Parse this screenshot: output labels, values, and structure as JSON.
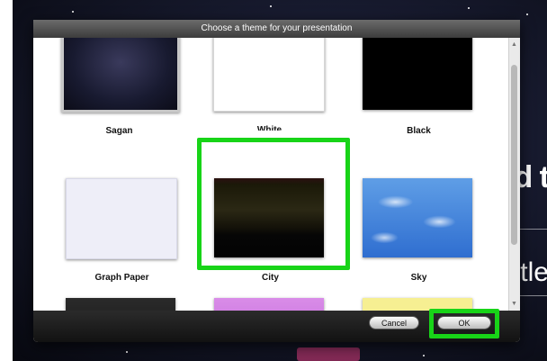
{
  "dialog": {
    "title": "Choose a theme for your presentation",
    "themes": [
      {
        "label": "Sagan"
      },
      {
        "label": "White"
      },
      {
        "label": "Black"
      },
      {
        "label": "Graph Paper"
      },
      {
        "label": "City"
      },
      {
        "label": "Sky"
      }
    ],
    "cancel_label": "Cancel",
    "ok_label": "OK"
  },
  "background_slide": {
    "text_fragment_1": "d t",
    "text_fragment_2": "itle"
  },
  "highlight_color": "#18d418",
  "icons": {
    "scroll_up": "scroll-up-arrow-icon",
    "scroll_down": "scroll-down-arrow-icon"
  }
}
